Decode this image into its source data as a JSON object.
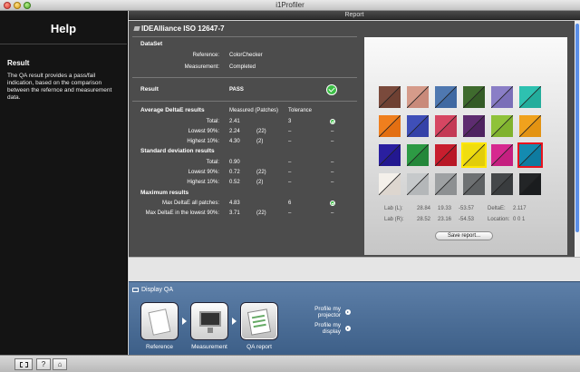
{
  "window": {
    "title": "i1Profiler"
  },
  "help": {
    "title": "Help",
    "section": "Result",
    "text": "The QA result provides a pass/fail indication, based on the comparison between the refernce and measurement data."
  },
  "report": {
    "header": "Report",
    "title": "IDEAlliance ISO 12647-7",
    "dataset_label": "DataSet",
    "reference_label": "Reference:",
    "reference_value": "ColorChecker",
    "measurement_label": "Measurement:",
    "measurement_value": "Completed",
    "result_label": "Result",
    "result_value": "PASS",
    "col_measured": "Measured (Patches)",
    "col_tolerance": "Tolerance",
    "avg_title": "Average DeltaE results",
    "avg_rows": [
      {
        "label": "Total:",
        "measured": "2.41",
        "patches": "",
        "tolerance": "3",
        "status": "check"
      },
      {
        "label": "Lowest 90%:",
        "measured": "2.24",
        "patches": "(22)",
        "tolerance": "–",
        "status": "–"
      },
      {
        "label": "Highest 10%:",
        "measured": "4.30",
        "patches": "(2)",
        "tolerance": "–",
        "status": "–"
      }
    ],
    "std_title": "Standard deviation results",
    "std_rows": [
      {
        "label": "Total:",
        "measured": "0.90",
        "patches": "",
        "tolerance": "–",
        "status": "–"
      },
      {
        "label": "Lowest 90%:",
        "measured": "0.72",
        "patches": "(22)",
        "tolerance": "–",
        "status": "–"
      },
      {
        "label": "Highest 10%:",
        "measured": "0.52",
        "patches": "(2)",
        "tolerance": "–",
        "status": "–"
      }
    ],
    "max_title": "Maximum results",
    "max_rows": [
      {
        "label": "Max DeltaE all patches:",
        "measured": "4.83",
        "patches": "",
        "tolerance": "6",
        "status": "check"
      },
      {
        "label": "Max DeltaE in the lowest 90%:",
        "measured": "3.71",
        "patches": "(22)",
        "tolerance": "–",
        "status": "–"
      }
    ],
    "lab_l_label": "Lab (L):",
    "lab_l": [
      "28.84",
      "19.33",
      "-53.57"
    ],
    "lab_r_label": "Lab (R):",
    "lab_r": [
      "28.52",
      "23.16",
      "-54.53"
    ],
    "deltae_label": "DeltaE:",
    "deltae_value": "2.117",
    "location_label": "Location:",
    "location_value": "0 0 1",
    "save_button": "Save report...",
    "swatches": [
      [
        "#7a4a3c",
        "#6e4032"
      ],
      [
        "#d59b8a",
        "#c98a7a"
      ],
      [
        "#4f78b0",
        "#4069a2"
      ],
      [
        "#3f6b2e",
        "#345b26"
      ],
      [
        "#8a7ec6",
        "#7b6fb8"
      ],
      [
        "#2ec1b0",
        "#23ad9c"
      ],
      [
        "#ef7f1e",
        "#e36f12"
      ],
      [
        "#3f4fb8",
        "#3542a8"
      ],
      [
        "#d64662",
        "#c43a55"
      ],
      [
        "#5e2c70",
        "#4f2360"
      ],
      [
        "#8fc23a",
        "#80b22e"
      ],
      [
        "#f0a21d",
        "#e39312"
      ],
      [
        "#2a1fa0",
        "#231890"
      ],
      [
        "#2d9a44",
        "#24873a"
      ],
      [
        "#c81e2e",
        "#b81826"
      ],
      [
        "#f0dd10",
        "#e2cd0a"
      ],
      [
        "#d6288f",
        "#c51f80"
      ],
      [
        "#148bb0",
        "#0e7ba0"
      ],
      [
        "#f4f0ea",
        "#ddd6cf"
      ],
      [
        "#c6c9cb",
        "#b4b7b9"
      ],
      [
        "#9ea1a3",
        "#8d9092"
      ],
      [
        "#6e7173",
        "#5e6163"
      ],
      [
        "#45484a",
        "#393c3e"
      ],
      [
        "#232527",
        "#1a1c1e"
      ]
    ]
  },
  "workflow": {
    "title": "Display QA",
    "steps": [
      "Reference",
      "Measurement",
      "QA report"
    ],
    "links": [
      "Profile my projector",
      "Profile my display"
    ]
  },
  "bottombar": {
    "help_button": "?"
  }
}
